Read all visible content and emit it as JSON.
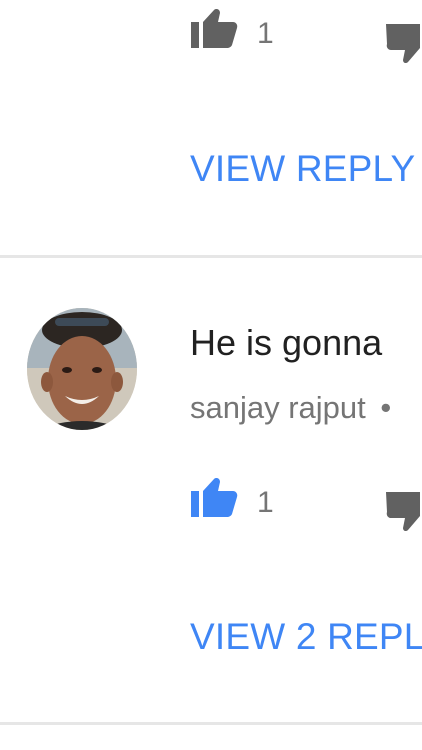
{
  "colors": {
    "accent": "#3f86f5",
    "icon_gray": "#616161",
    "secondary_text": "#757575",
    "divider": "#e6e6e6"
  },
  "comment_1": {
    "like_count": "1",
    "like_icon": "thumb-up-outline-gray",
    "dislike_icon": "thumb-down-gray",
    "view_replies_label": "VIEW REPLY"
  },
  "comment_2": {
    "avatar_icon": "user-avatar-photo",
    "text": "He is gonna",
    "author": "sanjay rajput",
    "meta_separator": "•",
    "like_count": "1",
    "like_icon": "thumb-up-filled-blue",
    "dislike_icon": "thumb-down-gray",
    "view_replies_label": "VIEW 2 REPL"
  }
}
